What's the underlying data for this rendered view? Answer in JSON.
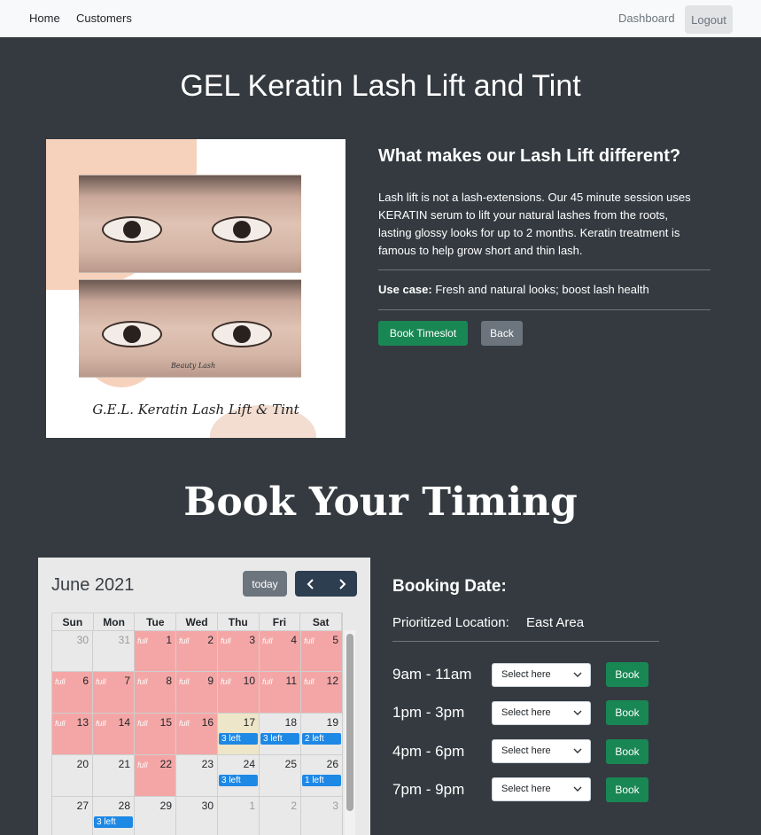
{
  "nav": {
    "home": "Home",
    "customers": "Customers",
    "dashboard": "Dashboard",
    "logout": "Logout"
  },
  "service": {
    "title": "GEL Keratin Lash Lift and Tint",
    "image_caption": "G.E.L. Keratin Lash Lift & Tint",
    "image_signature": "Beauty Lash",
    "heading": "What makes our Lash Lift different?",
    "description": "Lash lift is not a lash-extensions. Our 45 minute session uses KERATIN serum to lift your natural lashes from the roots, lasting glossy looks for up to 2 months. Keratin treatment is famous to help grow short and thin lash.",
    "use_case_label": "Use case:",
    "use_case_text": " Fresh and natural looks; boost lash health",
    "book_button": "Book Timeslot",
    "back_button": "Back"
  },
  "booking_heading": "Book Your Timing",
  "calendar": {
    "month": "June 2021",
    "today_button": "today",
    "prev_icon": "chevron-left-icon",
    "next_icon": "chevron-right-icon",
    "days": [
      "Sun",
      "Mon",
      "Tue",
      "Wed",
      "Thu",
      "Fri",
      "Sat"
    ],
    "full_label": "full",
    "full_color": "#f4a6a6",
    "event_color": "#1e88e5",
    "today_color": "#ede6c8",
    "weeks": [
      [
        {
          "day": "30",
          "other": true
        },
        {
          "day": "31",
          "other": true
        },
        {
          "day": "1",
          "full": true
        },
        {
          "day": "2",
          "full": true
        },
        {
          "day": "3",
          "full": true
        },
        {
          "day": "4",
          "full": true
        },
        {
          "day": "5",
          "full": true
        }
      ],
      [
        {
          "day": "6",
          "full": true
        },
        {
          "day": "7",
          "full": true
        },
        {
          "day": "8",
          "full": true
        },
        {
          "day": "9",
          "full": true
        },
        {
          "day": "10",
          "full": true
        },
        {
          "day": "11",
          "full": true
        },
        {
          "day": "12",
          "full": true
        }
      ],
      [
        {
          "day": "13",
          "full": true
        },
        {
          "day": "14",
          "full": true
        },
        {
          "day": "15",
          "full": true
        },
        {
          "day": "16",
          "full": true
        },
        {
          "day": "17",
          "today": true,
          "event": "3 left"
        },
        {
          "day": "18",
          "event": "3 left"
        },
        {
          "day": "19",
          "event": "2 left"
        }
      ],
      [
        {
          "day": "20"
        },
        {
          "day": "21"
        },
        {
          "day": "22",
          "full": true
        },
        {
          "day": "23"
        },
        {
          "day": "24",
          "event": "3 left"
        },
        {
          "day": "25"
        },
        {
          "day": "26",
          "event": "1 left"
        }
      ],
      [
        {
          "day": "27"
        },
        {
          "day": "28",
          "event": "3 left"
        },
        {
          "day": "29"
        },
        {
          "day": "30"
        },
        {
          "day": "1",
          "other": true
        },
        {
          "day": "2",
          "other": true
        },
        {
          "day": "3",
          "other": true
        }
      ]
    ]
  },
  "booking": {
    "title": "Booking Date:",
    "location_label": "Prioritized Location:",
    "location_value": "East Area",
    "select_placeholder": "Select here",
    "book_label": "Book",
    "slots": [
      "9am - 11am",
      "1pm - 3pm",
      "4pm - 6pm",
      "7pm - 9pm"
    ]
  }
}
